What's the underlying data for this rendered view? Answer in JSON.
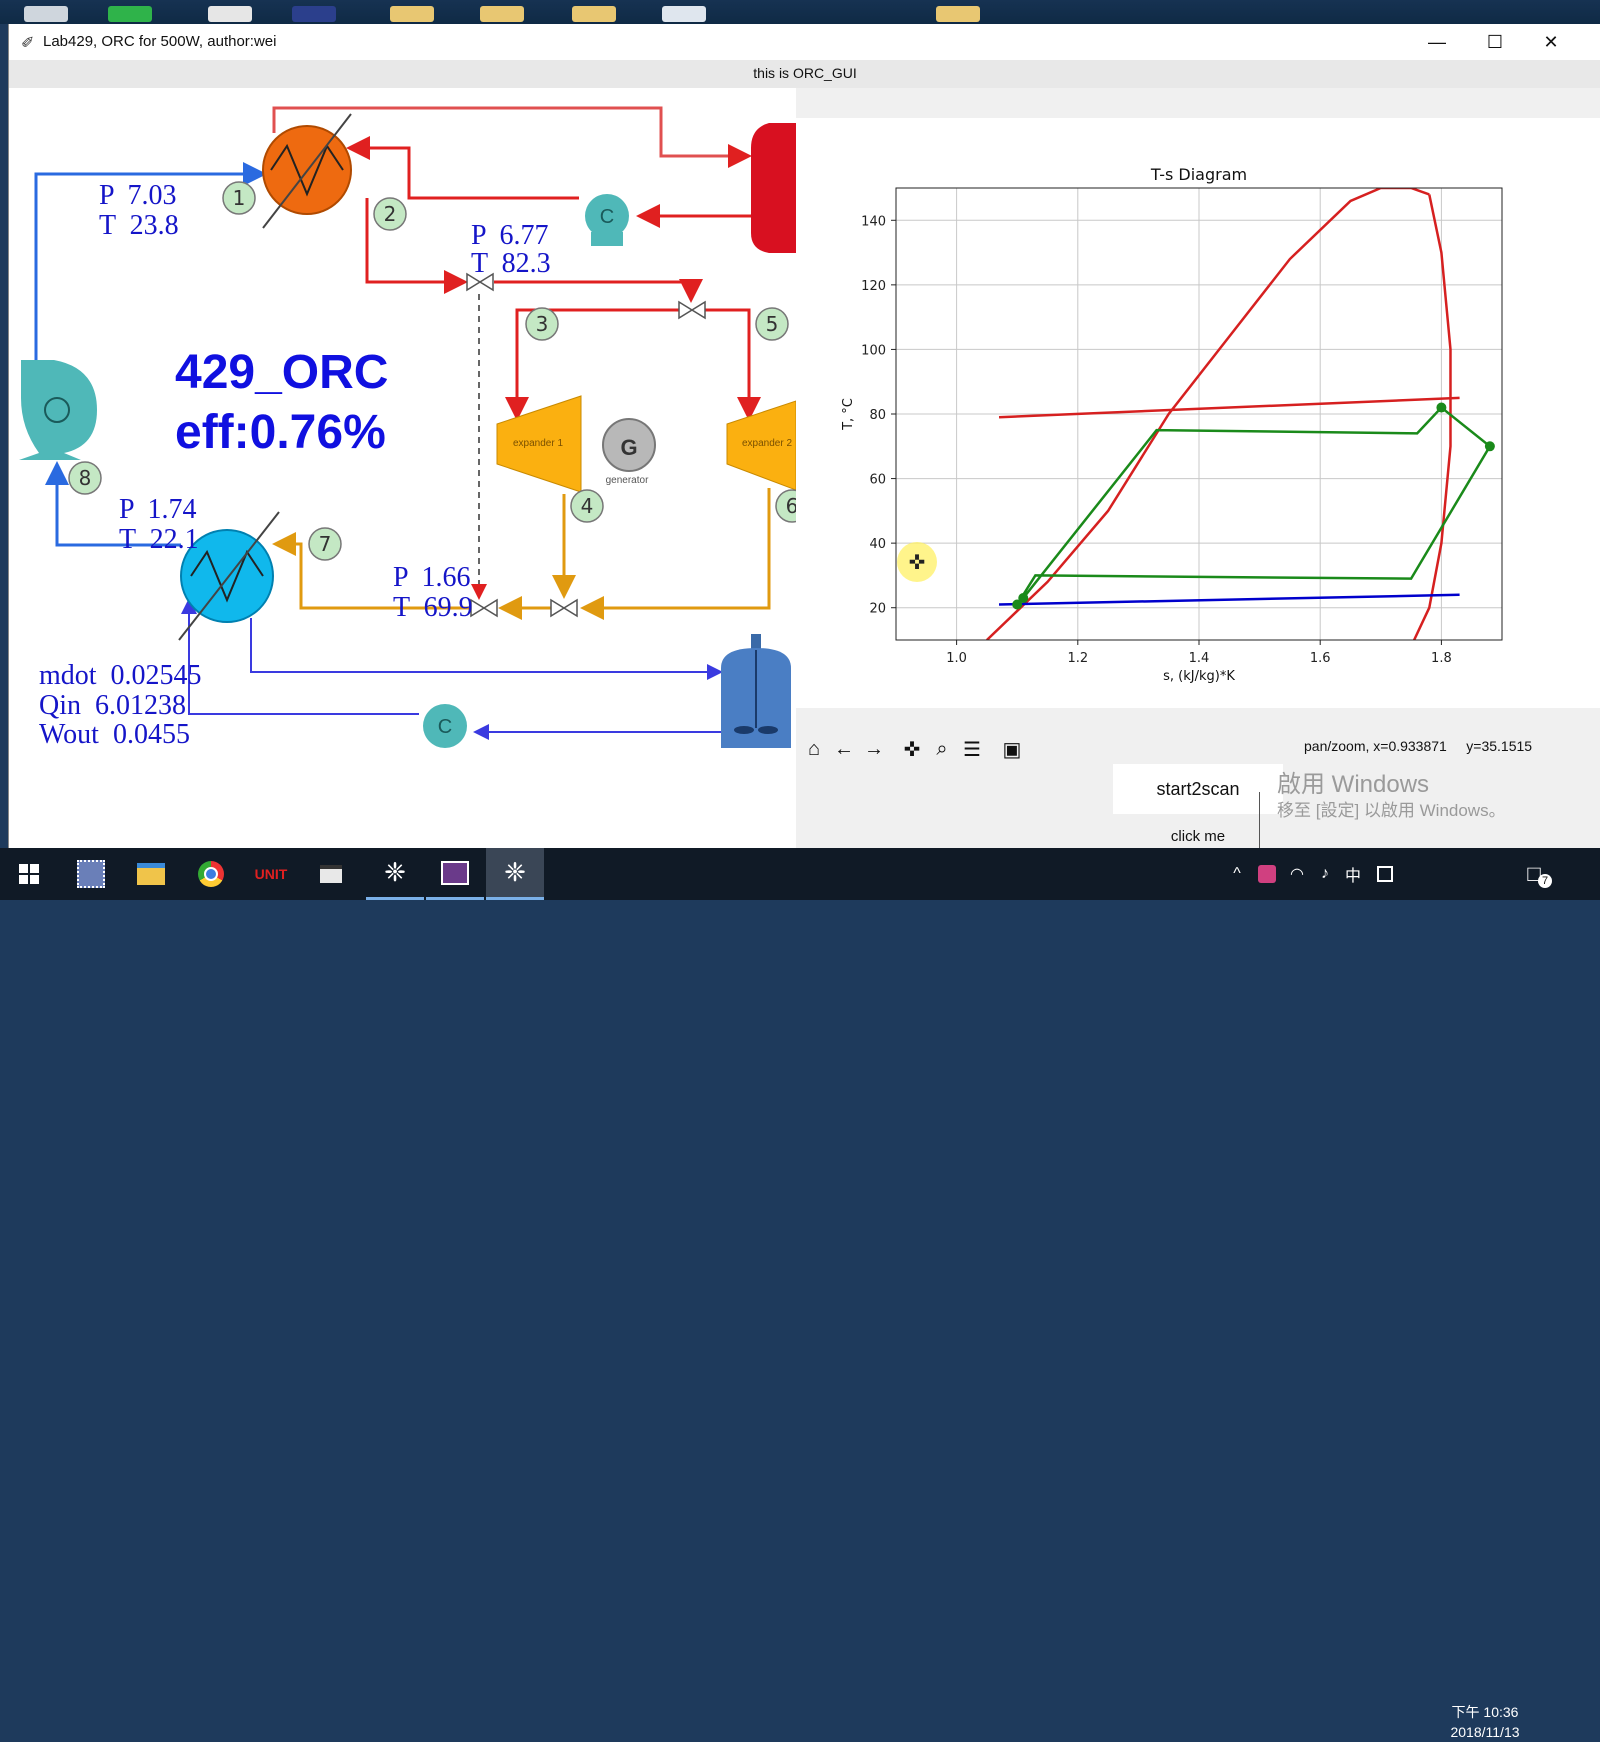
{
  "window": {
    "title": "Lab429, ORC for 500W, author:wei",
    "subtitle": "this is ORC_GUI",
    "controls": [
      "minimize-icon",
      "maximize-icon",
      "close-icon"
    ]
  },
  "diagram": {
    "brand": "429_ORC",
    "efficiency": "eff:0.76%",
    "readouts": [
      {
        "p": "P  7.03",
        "t": "T  23.8"
      },
      {
        "p": "P  6.77",
        "t": "T  82.3"
      },
      {
        "p": "P  1.74",
        "t": "T  22.1"
      },
      {
        "p": "P  1.66",
        "t": "T  69.9"
      }
    ],
    "summary": {
      "mdot": "mdot  0.02545",
      "qin": "Qin  6.01238",
      "wout": "Wout  0.0455"
    },
    "nodes": [
      "1",
      "2",
      "3",
      "4",
      "5",
      "6",
      "7",
      "8"
    ],
    "components": {
      "expander1": "expander 1",
      "expander2": "expander 2",
      "generator_symbol": "G",
      "generator": "generator",
      "pump_symbol": "C"
    }
  },
  "chart_data": {
    "type": "line",
    "title": "T-s Diagram",
    "xlabel": "s, (kJ/kg)*K",
    "ylabel": "T, °C",
    "xlim": [
      0.9,
      1.9
    ],
    "ylim": [
      10,
      150
    ],
    "xticks": [
      "1.0",
      "1.2",
      "1.4",
      "1.6",
      "1.8"
    ],
    "yticks": [
      "20",
      "40",
      "60",
      "80",
      "100",
      "120",
      "140"
    ],
    "grid": true,
    "series": [
      {
        "color": "#d62020",
        "x": [
          1.05,
          1.15,
          1.25,
          1.35,
          1.45,
          1.55,
          1.65,
          1.7,
          1.75,
          1.78
        ],
        "y": [
          10,
          28,
          50,
          80,
          104,
          128,
          146,
          150,
          150,
          148
        ]
      },
      {
        "color": "#d62020",
        "x": [
          1.78,
          1.8,
          1.815,
          1.815,
          1.8,
          1.78,
          1.755
        ],
        "y": [
          148,
          130,
          100,
          70,
          40,
          20,
          10
        ]
      },
      {
        "color": "#d62020",
        "x": [
          1.07,
          1.83
        ],
        "y": [
          79,
          85
        ]
      },
      {
        "color": "#0000cc",
        "x": [
          1.07,
          1.83
        ],
        "y": [
          21,
          24
        ]
      },
      {
        "color": "#1a8a1a",
        "x": [
          1.1,
          1.11,
          1.33,
          1.76,
          1.8,
          1.88,
          1.75,
          1.13,
          1.1
        ],
        "y": [
          21,
          23,
          75,
          74,
          82,
          70,
          29,
          30,
          21
        ]
      }
    ],
    "points": [
      {
        "x": 1.1,
        "y": 21
      },
      {
        "x": 1.11,
        "y": 23
      },
      {
        "x": 1.8,
        "y": 82
      },
      {
        "x": 1.88,
        "y": 70
      }
    ]
  },
  "toolbar": {
    "buttons": [
      "home-icon",
      "back-icon",
      "forward-icon",
      "pan-icon",
      "zoom-icon",
      "configure-icon",
      "save-icon"
    ],
    "status": "pan/zoom, x=0.933871     y=35.1515"
  },
  "actions": {
    "start_label": "start2scan",
    "click_label": "click me"
  },
  "watermark": {
    "line1": "啟用 Windows",
    "line2": "移至 [設定] 以啟用 Windows。"
  },
  "taskbar": {
    "apps": [
      "start-icon",
      "network-app-icon",
      "file-explorer-icon",
      "chrome-icon",
      "unit-app-icon",
      "folder-icon",
      "python-gui-icon",
      "media-app-icon",
      "python-gui-active-icon"
    ],
    "tray_items": [
      "^",
      "中"
    ],
    "time": "下午 10:36",
    "date": "2018/11/13",
    "notification_count": "7"
  },
  "colors": {
    "accent_red": "#d62020",
    "accent_blue": "#0000cc",
    "accent_green": "#1a8a1a",
    "readout_blue": "#1515c8"
  }
}
